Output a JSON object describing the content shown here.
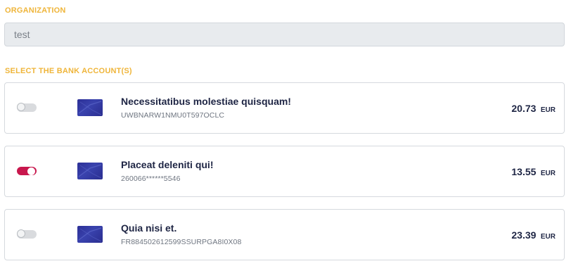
{
  "organization": {
    "label": "ORGANIZATION",
    "value": "test"
  },
  "bank_accounts": {
    "label": "SELECT THE BANK ACCOUNT(S)",
    "items": [
      {
        "name": "Necessitatibus molestiae quisquam!",
        "number": "UWBNARW1NMU0T597OCLC",
        "amount": "20.73",
        "currency": "EUR",
        "selected": false
      },
      {
        "name": "Placeat deleniti qui!",
        "number": "260066******5546",
        "amount": "13.55",
        "currency": "EUR",
        "selected": true
      },
      {
        "name": "Quia nisi et.",
        "number": "FR884502612599SSURPGA8I0X08",
        "amount": "23.39",
        "currency": "EUR",
        "selected": false
      }
    ]
  },
  "colors": {
    "section_label": "#efb53a",
    "toggle_on": "#c8174d",
    "toggle_off": "#d9dbde",
    "card_icon": "#2c2f96",
    "text_primary": "#1e2544"
  },
  "icons": {
    "card": "bank-card-icon"
  }
}
